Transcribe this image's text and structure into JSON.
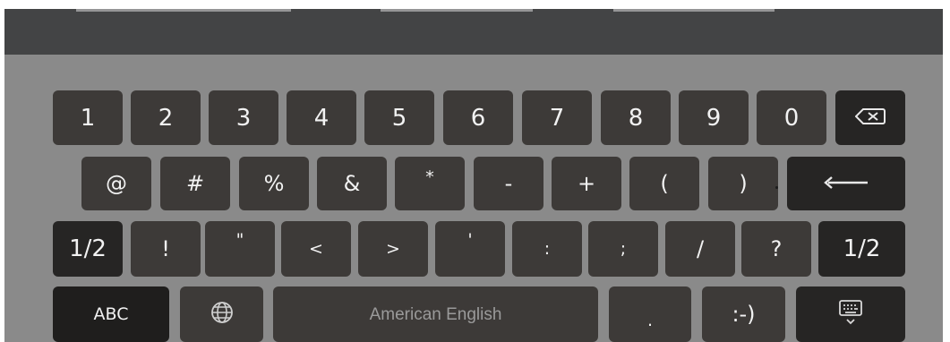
{
  "keyboard": {
    "row1": [
      "1",
      "2",
      "3",
      "4",
      "5",
      "6",
      "7",
      "8",
      "9",
      "0"
    ],
    "row2": [
      "@",
      "#",
      "%",
      "&",
      "*",
      "-",
      "+",
      "(",
      ")"
    ],
    "row3": {
      "shift_left": "1/2",
      "keys": [
        "!",
        "\"",
        "<",
        ">",
        "'",
        ":",
        ";",
        "/",
        "?"
      ],
      "shift_right": "1/2"
    },
    "row4": {
      "abc": "ABC",
      "space": "American English",
      "period": ".",
      "smiley": ":-)"
    },
    "icons": {
      "backspace": "backspace-icon",
      "enter": "enter-icon",
      "globe": "globe-icon",
      "hide_keyboard": "keyboard-hide-icon"
    },
    "colors": {
      "key": "#3d3a38",
      "key_dark": "#262524",
      "key_abc": "#1f1e1d",
      "panel": "#8a8a8a",
      "topbar": "#434445"
    }
  }
}
